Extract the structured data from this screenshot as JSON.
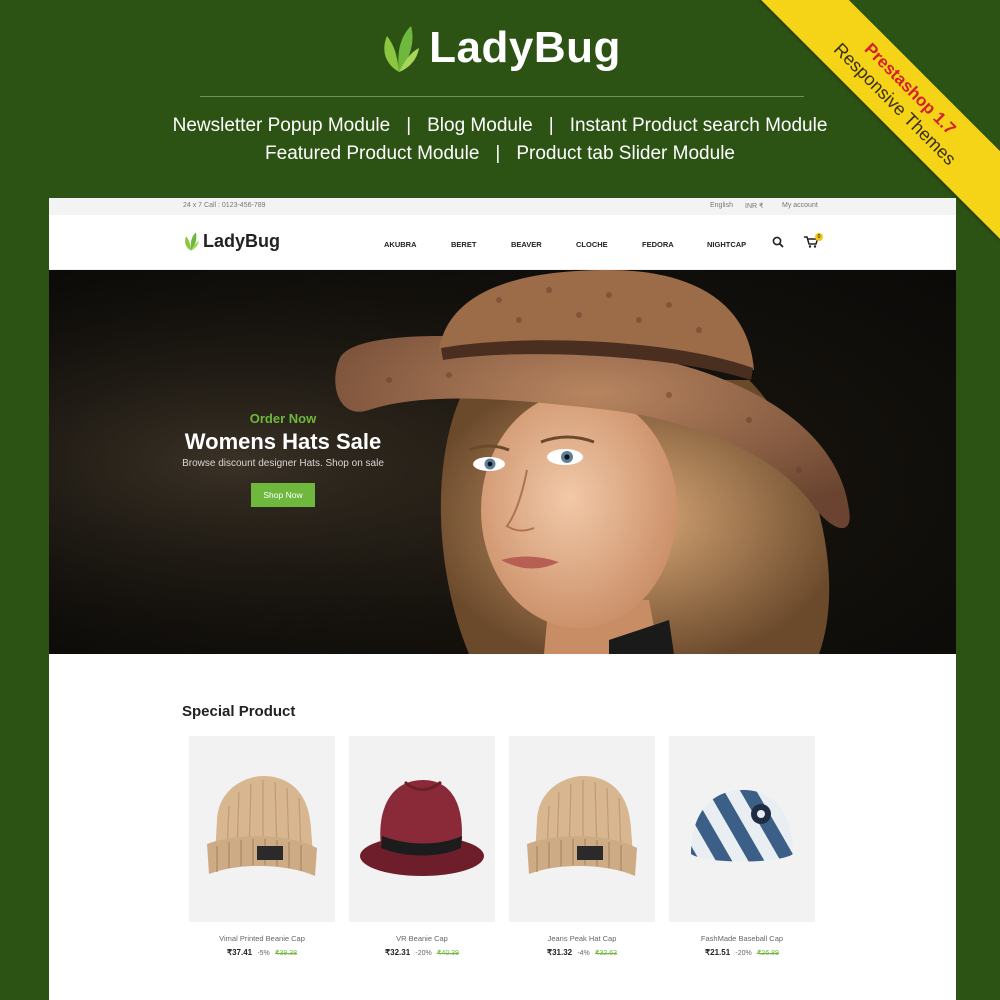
{
  "promo": {
    "brand": "LadyBug",
    "features_line1": [
      "Newsletter Popup Module",
      "Blog Module",
      "Instant Product search Module"
    ],
    "features_line2": [
      "Featured Product Module",
      "Product tab Slider Module"
    ],
    "separator": "|",
    "ribbon_line1": "Prestashop 1.7",
    "ribbon_line2": "Responsive Themes"
  },
  "topbar": {
    "call": "24 x 7 Call : 0123-456-789",
    "language": "English",
    "currency": "INR ₹",
    "account": "My account"
  },
  "nav": {
    "brand": "LadyBug",
    "menu": [
      "AKUBRA",
      "BERET",
      "BEAVER",
      "CLOCHE",
      "FEDORA",
      "NIGHTCAP"
    ],
    "cart_count": "0"
  },
  "hero": {
    "eyebrow": "Order Now",
    "title": "Womens Hats Sale",
    "subtitle": "Browse discount designer Hats. Shop on sale",
    "button": "Shop Now"
  },
  "special": {
    "title": "Special Product",
    "products": [
      {
        "name": "Vimal Printed Beanie Cap",
        "price": "₹37.41",
        "discount": "-5%",
        "old_price": "₹39.38",
        "image": "beanie"
      },
      {
        "name": "VR Beanie Cap",
        "price": "₹32.31",
        "discount": "-20%",
        "old_price": "₹40.39",
        "image": "fedora"
      },
      {
        "name": "Jeans Peak Hat Cap",
        "price": "₹31.32",
        "discount": "-4%",
        "old_price": "₹32.63",
        "image": "beanie"
      },
      {
        "name": "FashMade Baseball Cap",
        "price": "₹21.51",
        "discount": "-20%",
        "old_price": "₹26.89",
        "image": "bucket-hat"
      }
    ]
  },
  "colors": {
    "background": "#2d5314",
    "accent_green": "#6eb83d",
    "ribbon_yellow": "#f5d418",
    "ribbon_red": "#d4202a"
  }
}
